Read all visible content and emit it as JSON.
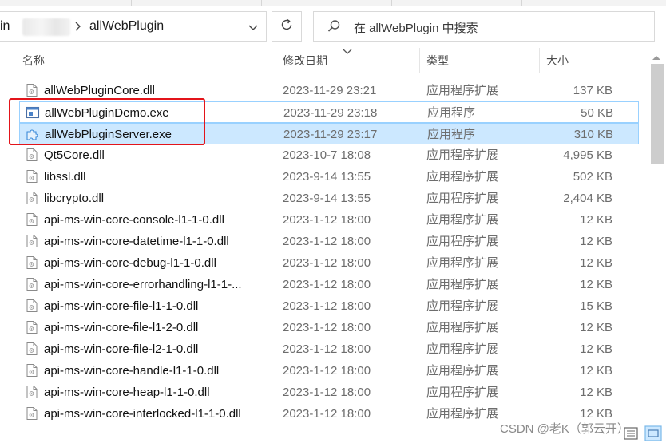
{
  "address": {
    "cut_crumb": "in",
    "current_folder": "allWebPlugin"
  },
  "search": {
    "placeholder": "在 allWebPlugin 中搜索"
  },
  "columns": {
    "name": "名称",
    "date": "修改日期",
    "type": "类型",
    "size": "大小"
  },
  "files": [
    {
      "name": "allWebPluginCore.dll",
      "date": "2023-11-29 23:21",
      "type": "应用程序扩展",
      "size": "137 KB",
      "icon": "dll-file-icon",
      "state": "normal"
    },
    {
      "name": "allWebPluginDemo.exe",
      "date": "2023-11-29 23:18",
      "type": "应用程序",
      "size": "50 KB",
      "icon": "exe-window-icon",
      "state": "hover"
    },
    {
      "name": "allWebPluginServer.exe",
      "date": "2023-11-29 23:17",
      "type": "应用程序",
      "size": "310 KB",
      "icon": "puzzle-icon",
      "state": "selected"
    },
    {
      "name": "Qt5Core.dll",
      "date": "2023-10-7 18:08",
      "type": "应用程序扩展",
      "size": "4,995 KB",
      "icon": "dll-file-icon",
      "state": "normal"
    },
    {
      "name": "libssl.dll",
      "date": "2023-9-14 13:55",
      "type": "应用程序扩展",
      "size": "502 KB",
      "icon": "dll-file-icon",
      "state": "normal"
    },
    {
      "name": "libcrypto.dll",
      "date": "2023-9-14 13:55",
      "type": "应用程序扩展",
      "size": "2,404 KB",
      "icon": "dll-file-icon",
      "state": "normal"
    },
    {
      "name": "api-ms-win-core-console-l1-1-0.dll",
      "date": "2023-1-12 18:00",
      "type": "应用程序扩展",
      "size": "12 KB",
      "icon": "dll-file-icon",
      "state": "normal"
    },
    {
      "name": "api-ms-win-core-datetime-l1-1-0.dll",
      "date": "2023-1-12 18:00",
      "type": "应用程序扩展",
      "size": "12 KB",
      "icon": "dll-file-icon",
      "state": "normal"
    },
    {
      "name": "api-ms-win-core-debug-l1-1-0.dll",
      "date": "2023-1-12 18:00",
      "type": "应用程序扩展",
      "size": "12 KB",
      "icon": "dll-file-icon",
      "state": "normal"
    },
    {
      "name": "api-ms-win-core-errorhandling-l1-1-...",
      "date": "2023-1-12 18:00",
      "type": "应用程序扩展",
      "size": "12 KB",
      "icon": "dll-file-icon",
      "state": "normal"
    },
    {
      "name": "api-ms-win-core-file-l1-1-0.dll",
      "date": "2023-1-12 18:00",
      "type": "应用程序扩展",
      "size": "15 KB",
      "icon": "dll-file-icon",
      "state": "normal"
    },
    {
      "name": "api-ms-win-core-file-l1-2-0.dll",
      "date": "2023-1-12 18:00",
      "type": "应用程序扩展",
      "size": "12 KB",
      "icon": "dll-file-icon",
      "state": "normal"
    },
    {
      "name": "api-ms-win-core-file-l2-1-0.dll",
      "date": "2023-1-12 18:00",
      "type": "应用程序扩展",
      "size": "12 KB",
      "icon": "dll-file-icon",
      "state": "normal"
    },
    {
      "name": "api-ms-win-core-handle-l1-1-0.dll",
      "date": "2023-1-12 18:00",
      "type": "应用程序扩展",
      "size": "12 KB",
      "icon": "dll-file-icon",
      "state": "normal"
    },
    {
      "name": "api-ms-win-core-heap-l1-1-0.dll",
      "date": "2023-1-12 18:00",
      "type": "应用程序扩展",
      "size": "12 KB",
      "icon": "dll-file-icon",
      "state": "normal"
    },
    {
      "name": "api-ms-win-core-interlocked-l1-1-0.dll",
      "date": "2023-1-12 18:00",
      "type": "应用程序扩展",
      "size": "12 KB",
      "icon": "dll-file-icon",
      "state": "normal"
    }
  ],
  "watermark": "CSDN @老K（郭云开）",
  "colors": {
    "selection_bg": "#cce8ff",
    "selection_border": "#99d1ff",
    "annotation_red": "#e3141a"
  }
}
